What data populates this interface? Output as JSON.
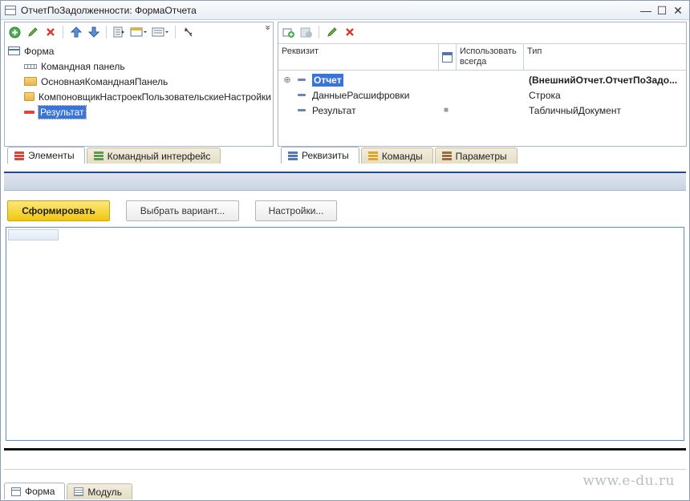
{
  "window": {
    "title": "ОтчетПоЗадолженности: ФормаОтчета",
    "controls": {
      "minimize": "—",
      "maximize": "☐",
      "close": "✕"
    }
  },
  "elements_panel": {
    "toolbar": {
      "icons": [
        "add-circle-icon",
        "pencil-icon",
        "delete-x-icon",
        "arrow-up-icon",
        "arrow-down-icon",
        "tab-order-icon",
        "form-view-icon",
        "layout-icon",
        "refresh-icon"
      ],
      "more": "»"
    },
    "tree": [
      {
        "label": "Форма",
        "icon": "form-icon",
        "level": 0
      },
      {
        "label": "Командная панель",
        "icon": "command-panel-icon",
        "level": 1
      },
      {
        "label": "ОсновнаяКоманднаяПанель",
        "icon": "folder-icon",
        "level": 1
      },
      {
        "label": "КомпоновщикНастроекПользовательскиеНастройки",
        "icon": "folder-icon",
        "level": 1
      },
      {
        "label": "Результат",
        "icon": "result-icon",
        "level": 1,
        "selected": true
      }
    ],
    "tabs": [
      {
        "label": "Элементы",
        "icon": "elements-icon",
        "active": true
      },
      {
        "label": "Командный интерфейс",
        "icon": "command-interface-icon",
        "active": false
      }
    ]
  },
  "attributes_panel": {
    "toolbar": {
      "icons": [
        "add-attribute-icon",
        "add-column-icon",
        "pencil-icon",
        "delete-x-icon"
      ]
    },
    "columns": {
      "name": "Реквизит",
      "always_use": "Использовать всегда",
      "type": "Тип"
    },
    "rows": [
      {
        "name": "Отчет",
        "always": "",
        "type": "(ВнешнийОтчет.ОтчетПоЗадо...",
        "expandable": true,
        "selected": true,
        "bold": true
      },
      {
        "name": "ДанныеРасшифровки",
        "always": "",
        "type": "Строка",
        "expandable": false
      },
      {
        "name": "Результат",
        "always": "■",
        "type": "ТабличныйДокумент",
        "expandable": false
      }
    ],
    "tabs": [
      {
        "label": "Реквизиты",
        "icon": "attributes-icon",
        "active": true
      },
      {
        "label": "Команды",
        "icon": "commands-icon",
        "active": false
      },
      {
        "label": "Параметры",
        "icon": "parameters-icon",
        "active": false
      }
    ]
  },
  "preview": {
    "buttons": {
      "generate": "Сформировать",
      "choose_variant": "Выбрать вариант...",
      "settings": "Настройки..."
    }
  },
  "bottom_tabs": [
    {
      "label": "Форма",
      "icon": "form-icon",
      "active": true
    },
    {
      "label": "Модуль",
      "icon": "module-icon",
      "active": false
    }
  ],
  "watermark": "www.e-du.ru",
  "colors": {
    "selection": "#3875d7",
    "primary_button": "#f1c710",
    "panel_border": "#a7b4c5",
    "sheet_border": "#5b8bd1"
  }
}
